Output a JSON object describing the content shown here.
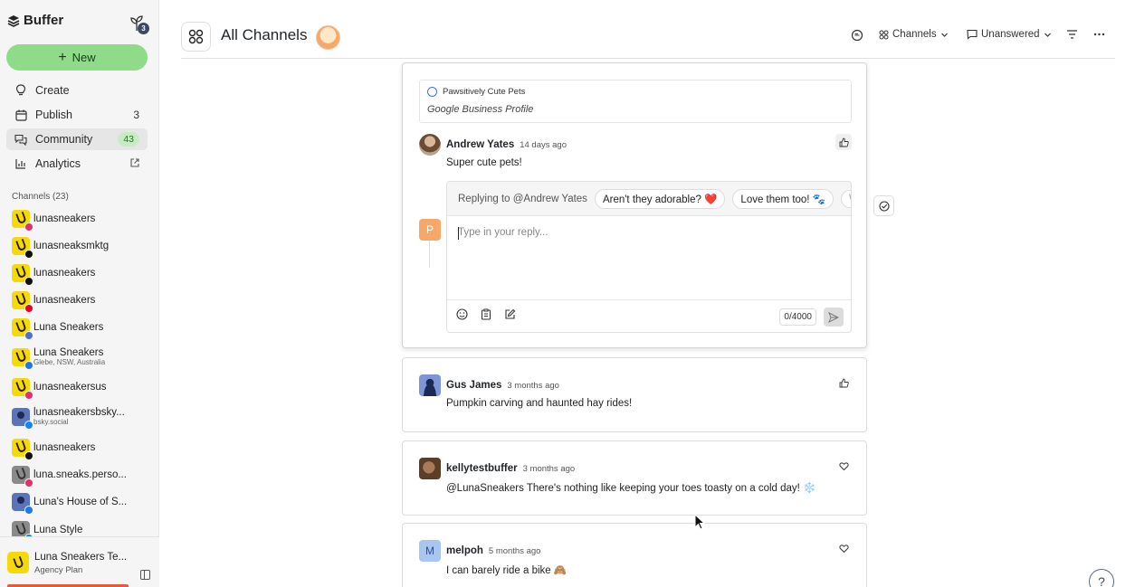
{
  "app": {
    "logo_text": "Buffer",
    "notification_count": "3"
  },
  "sidebar": {
    "new_label": "New",
    "nav": [
      {
        "label": "Create",
        "count": "",
        "icon": "lightbulb-icon"
      },
      {
        "label": "Publish",
        "count": "3",
        "icon": "calendar-icon"
      },
      {
        "label": "Community",
        "count": "43",
        "icon": "chat-bubbles-icon"
      },
      {
        "label": "Analytics",
        "count": "",
        "icon": "bar-chart-icon"
      }
    ],
    "channels_label": "Channels (23)",
    "channels": [
      {
        "name": "lunasneakers",
        "sub": "",
        "network": "instagram",
        "net_color": "#e1306c",
        "avatar": "luna"
      },
      {
        "name": "lunasneaksmktg",
        "sub": "",
        "network": "x",
        "net_color": "#111111",
        "avatar": "luna"
      },
      {
        "name": "lunasneakers",
        "sub": "",
        "network": "tiktok",
        "net_color": "#111111",
        "avatar": "luna"
      },
      {
        "name": "lunasneakers",
        "sub": "",
        "network": "pinterest",
        "net_color": "#e60023",
        "avatar": "luna"
      },
      {
        "name": "Luna Sneakers",
        "sub": "",
        "network": "google-business",
        "net_color": "#4a6fd6",
        "avatar": "luna"
      },
      {
        "name": "Luna Sneakers",
        "sub": "Glebe, NSW, Australia",
        "network": "facebook",
        "net_color": "#1877f2",
        "avatar": "luna"
      },
      {
        "name": "lunasneakersus",
        "sub": "",
        "network": "instagram",
        "net_color": "#e1306c",
        "avatar": "luna"
      },
      {
        "name": "lunasneakersbsky...",
        "sub": "bsky.social",
        "network": "bluesky",
        "net_color": "#1185fe",
        "avatar": "person"
      },
      {
        "name": "lunasneakers",
        "sub": "",
        "network": "threads",
        "net_color": "#111111",
        "avatar": "luna"
      },
      {
        "name": "luna.sneaks.perso...",
        "sub": "",
        "network": "instagram",
        "net_color": "#e1306c",
        "avatar": "pet"
      },
      {
        "name": "Luna's House of S...",
        "sub": "",
        "network": "facebook",
        "net_color": "#1877f2",
        "avatar": "person"
      },
      {
        "name": "Luna Style",
        "sub": "",
        "network": "facebook",
        "net_color": "#1877f2",
        "avatar": "pet"
      }
    ],
    "org": {
      "name": "Luna Sneakers Te...",
      "plan": "Agency Plan"
    }
  },
  "header": {
    "title": "All Channels",
    "channels_filter": "Channels",
    "status_filter": "Unanswered"
  },
  "comments": [
    {
      "source_name": "Pawsitively Cute Pets",
      "source_platform": "Google Business Profile",
      "author": "Andrew Yates",
      "time": "14 days ago",
      "text": "Super cute pets!",
      "reaction": "thumbs-up-icon",
      "reply": {
        "replying_to": "Replying to @Andrew Yates",
        "suggestions": [
          "Aren't they adorable? ❤️",
          "Love them too! 🐾",
          "Wh"
        ],
        "placeholder": "Type in your reply...",
        "counter": "0/4000",
        "avatar_letter": "P"
      }
    },
    {
      "author": "Gus James",
      "time": "3 months ago",
      "text": "Pumpkin carving and haunted hay rides!",
      "reaction": "thumbs-up-icon"
    },
    {
      "author": "kellytestbuffer",
      "time": "3 months ago",
      "text": "@LunaSneakers There's nothing like keeping your toes toasty on a cold day! ❄️",
      "reaction": "heart-icon"
    },
    {
      "author": "melpoh",
      "time": "5 months ago",
      "text": "I can barely ride a bike 🙈",
      "reaction": "heart-icon",
      "avatar_letter": "M"
    }
  ],
  "help_label": "?"
}
